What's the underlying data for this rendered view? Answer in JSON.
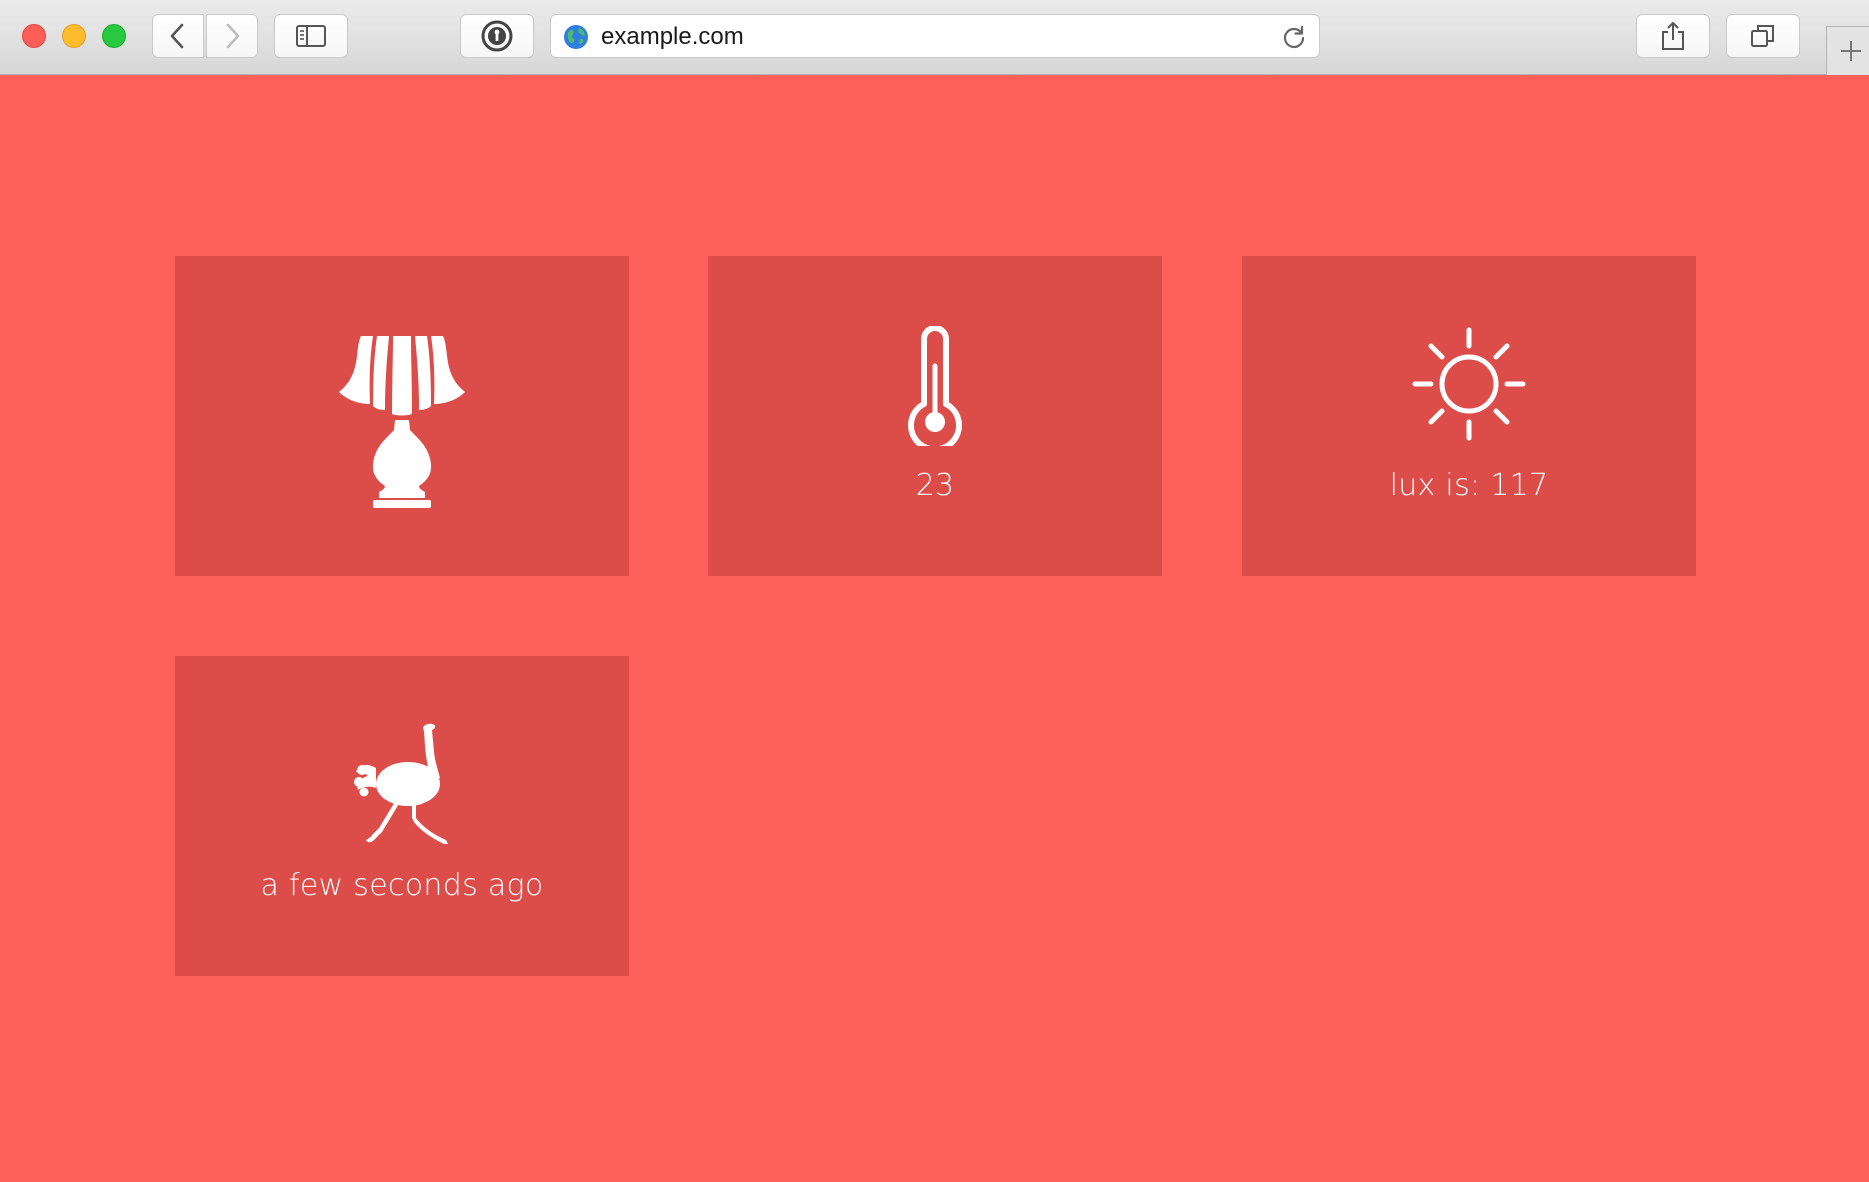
{
  "browser": {
    "url": "example.com",
    "icons": {
      "close": "close-dot",
      "minimize": "minimize-dot",
      "zoom": "zoom-dot",
      "back": "chevron-left-icon",
      "forward": "chevron-right-icon",
      "sidebar": "sidebar-icon",
      "password": "keyhole-icon",
      "site": "globe-icon",
      "reload": "reload-icon",
      "share": "share-icon",
      "tabs": "tabs-overview-icon",
      "new_tab": "plus-icon"
    }
  },
  "theme": {
    "background": "#fd5f5a",
    "tile": "#dc4d4a",
    "text": "#ffffff"
  },
  "tiles": [
    {
      "icon": "lamp-icon",
      "label": ""
    },
    {
      "icon": "thermometer-icon",
      "label": "23"
    },
    {
      "icon": "sun-icon",
      "label": "lux is: 117"
    },
    {
      "icon": "ostrich-icon",
      "label": "a few seconds ago"
    }
  ]
}
